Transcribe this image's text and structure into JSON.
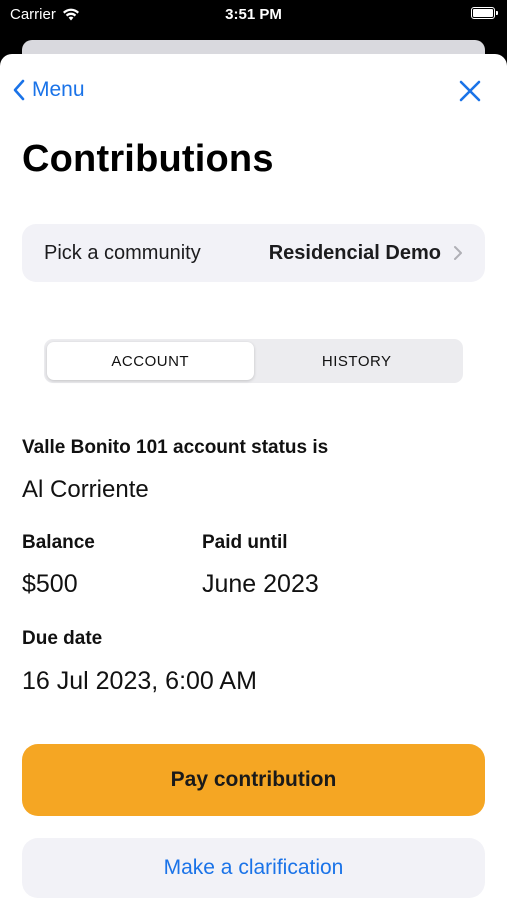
{
  "status_bar": {
    "carrier": "Carrier",
    "time": "3:51 PM"
  },
  "nav": {
    "back_label": "Menu",
    "close_icon": "close-icon"
  },
  "title": "Contributions",
  "community_picker": {
    "label": "Pick a community",
    "value": "Residencial Demo"
  },
  "tabs": [
    {
      "label": "ACCOUNT",
      "selected": true
    },
    {
      "label": "HISTORY",
      "selected": false
    }
  ],
  "account": {
    "status_label": "Valle Bonito 101 account status is",
    "status_value": "Al Corriente",
    "balance_label": "Balance",
    "balance_value": "$500",
    "paid_until_label": "Paid until",
    "paid_until_value": "June 2023",
    "due_date_label": "Due date",
    "due_date_value": "16 Jul 2023, 6:00 AM"
  },
  "actions": {
    "pay_label": "Pay contribution",
    "clarify_label": "Make a clarification"
  },
  "colors": {
    "accent": "#1a73e8",
    "pay_button": "#f5a623"
  }
}
